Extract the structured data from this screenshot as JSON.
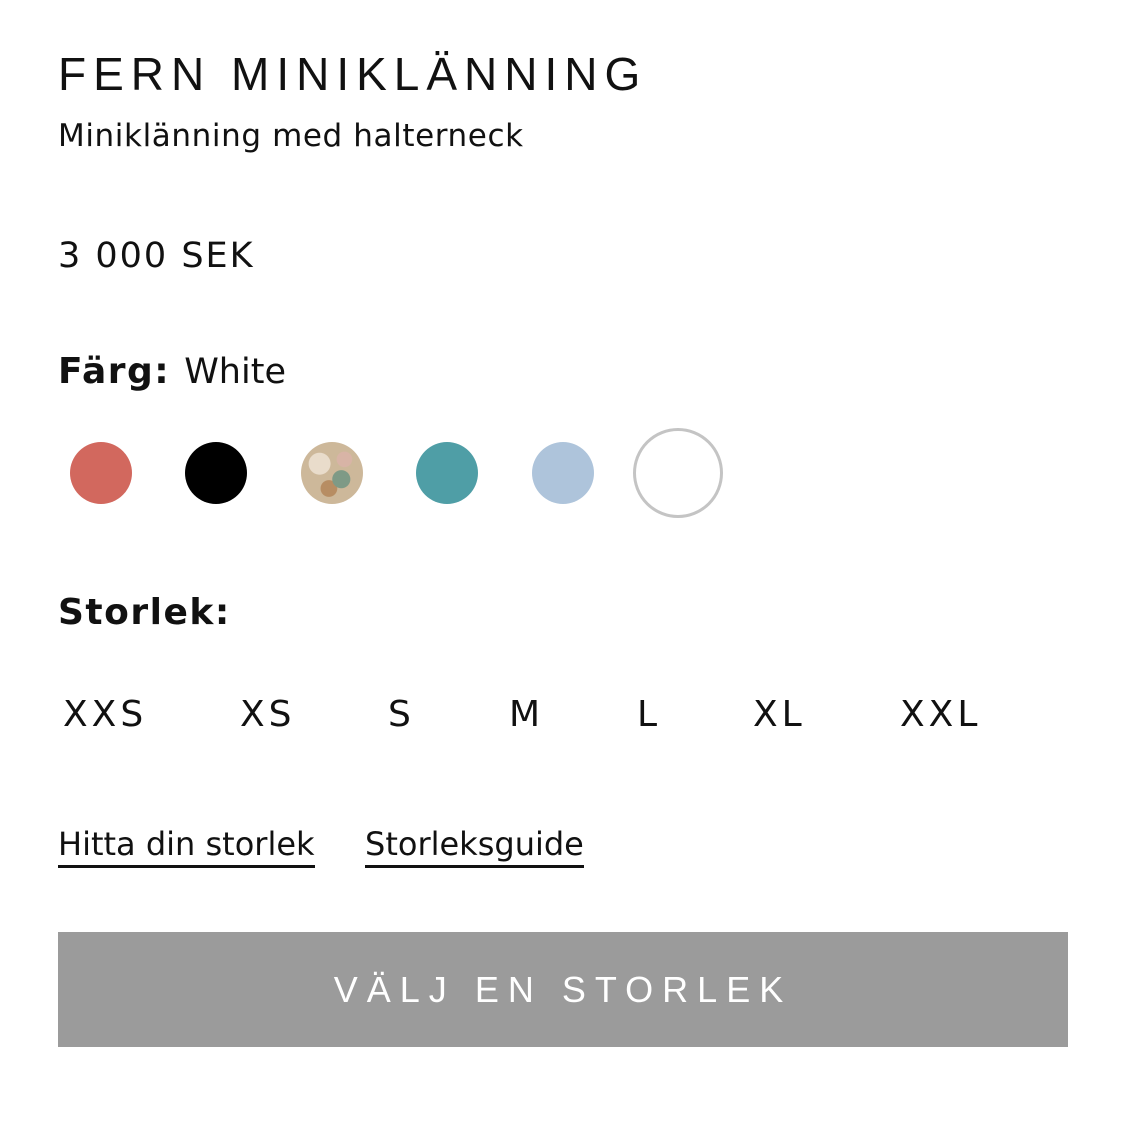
{
  "product": {
    "title": "FERN MINIKLÄNNING",
    "subtitle": "Miniklänning med halterneck",
    "price": "3 000 SEK"
  },
  "color": {
    "label": "Färg:",
    "selected": "White",
    "swatches": [
      {
        "name": "coral",
        "color": "#d2685e"
      },
      {
        "name": "black",
        "color": "#000000"
      },
      {
        "name": "floral-print",
        "color": "#c9b596"
      },
      {
        "name": "teal",
        "color": "#4f9ea6"
      },
      {
        "name": "light-blue",
        "color": "#aec4db"
      },
      {
        "name": "white",
        "color": "#ffffff"
      }
    ]
  },
  "size": {
    "label": "Storlek:",
    "options": [
      "XXS",
      "XS",
      "S",
      "M",
      "L",
      "XL",
      "XXL"
    ]
  },
  "links": {
    "find_size": "Hitta din storlek",
    "size_guide": "Storleksguide"
  },
  "cta": {
    "label": "VÄLJ EN STORLEK",
    "background": "#9b9b9b",
    "text_color": "#ffffff"
  }
}
